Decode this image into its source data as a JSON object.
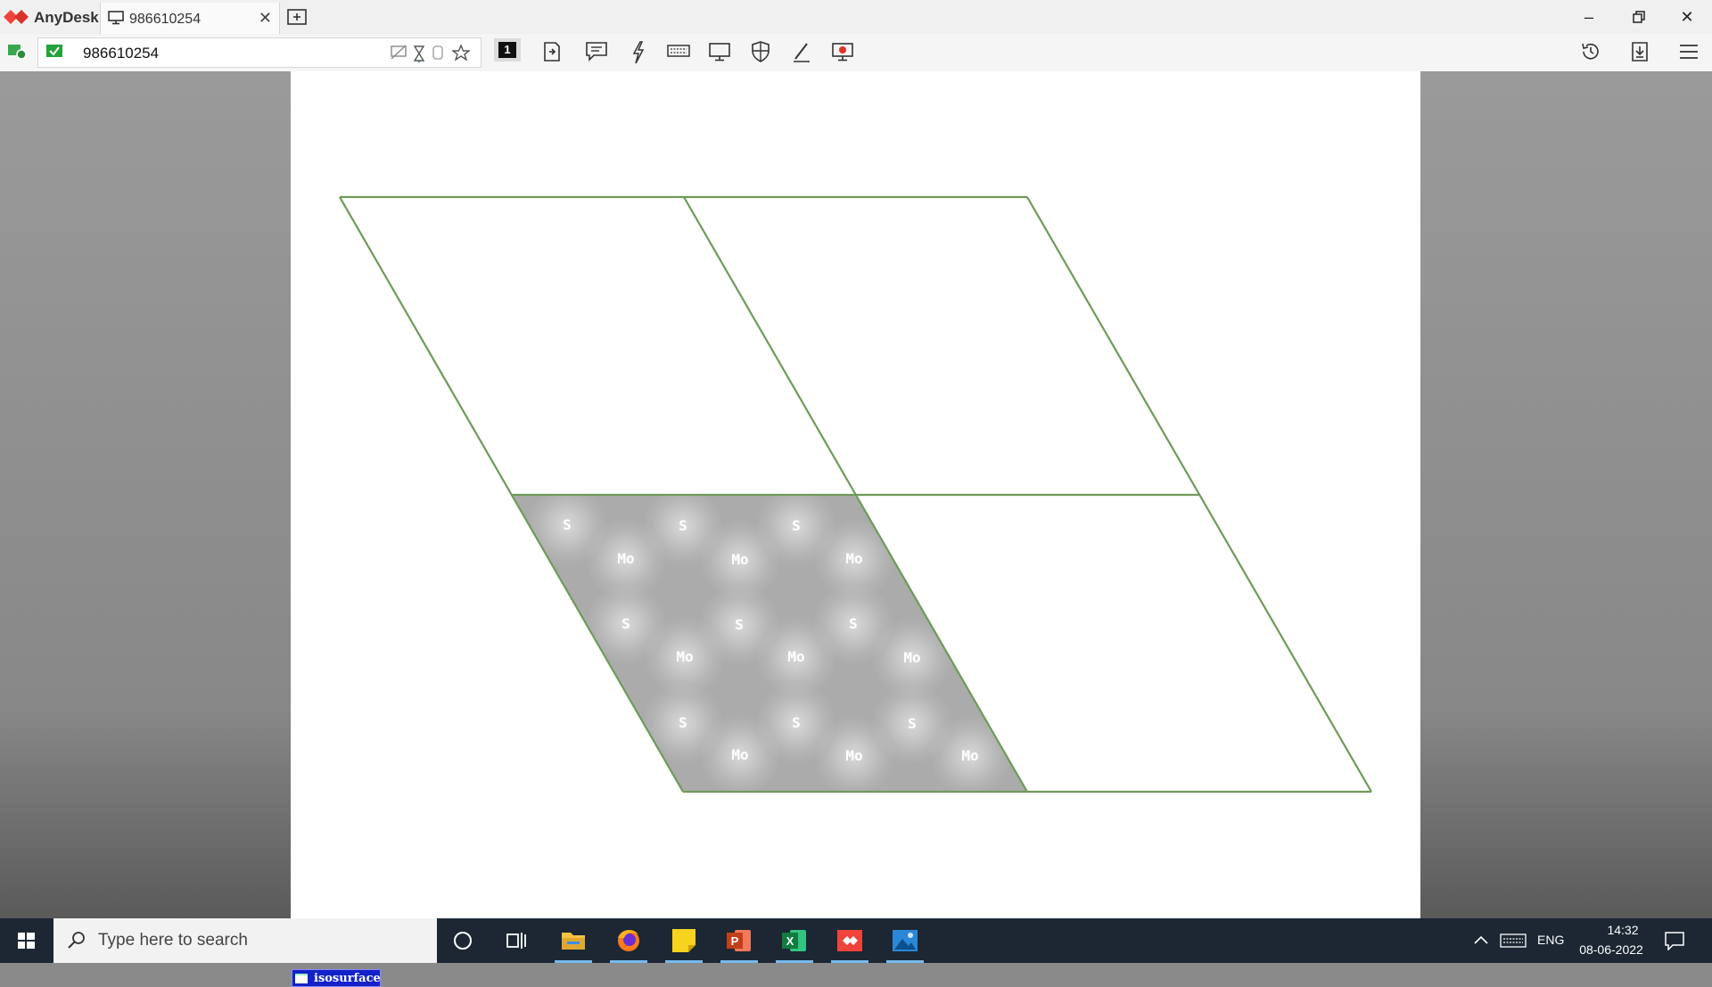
{
  "app": {
    "name": "AnyDesk",
    "tab_label": "986610254",
    "address": "986610254",
    "brand_color": "#ef443b"
  },
  "toolbar": {
    "icons": [
      "display-1-icon",
      "file-transfer-icon",
      "chat-icon",
      "actions-icon",
      "keyboard-icon",
      "display-icon",
      "permissions-icon",
      "whiteboard-icon",
      "record-icon",
      "history-icon",
      "download-icon",
      "menu-icon"
    ],
    "display_number": "1"
  },
  "remote": {
    "atom_labels": {
      "sulfur": "S",
      "molybdenum": "Mo"
    },
    "window_badge": "isosurface",
    "cell_line_color": "#6f9a5b"
  },
  "taskbar": {
    "search_placeholder": "Type here to search",
    "language": "ENG",
    "time": "14:32",
    "date": "08-06-2022",
    "apps": [
      "file-explorer",
      "firefox",
      "sticky-notes",
      "powerpoint",
      "excel",
      "anydesk",
      "photos"
    ]
  }
}
